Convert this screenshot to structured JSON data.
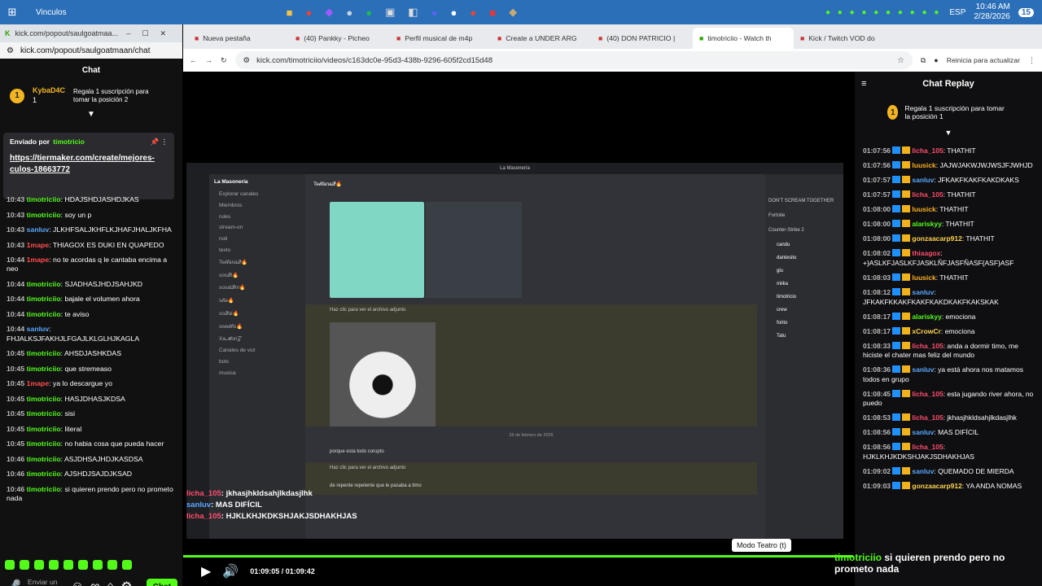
{
  "taskbar": {
    "start_label": "Vinculos",
    "time": "10:46 AM",
    "date": "2/28/2026",
    "lang": "ESP",
    "notif": "15"
  },
  "left_window": {
    "tab_title": "kick.com/popout/saulgoatmaa...",
    "url": "kick.com/popout/saulgoatmaan/chat",
    "chat_title": "Chat",
    "top_user": {
      "name": "KybaD4C",
      "count": "1",
      "rank": "1"
    },
    "gift_text": "Regala 1 suscripción para tomar la posición 2",
    "pinned": {
      "by": "Enviado por",
      "by_user": "timotricio",
      "link": "https://tiermaker.com/create/mejores-culos-18663772"
    },
    "messages": [
      {
        "time": "10:43",
        "user": "timotriciio",
        "color": "#53fc18",
        "text": "HDAJSHDJASHDJKAS"
      },
      {
        "time": "10:43",
        "user": "timotriciio",
        "color": "#53fc18",
        "text": "soy un p"
      },
      {
        "time": "10:43",
        "user": "sanluv",
        "color": "#5aa8ff",
        "text": "JLKHFSALJKHFLKJHAFJHALJKFHA"
      },
      {
        "time": "10:43",
        "user": "1mape",
        "color": "#ff4d4d",
        "text": "THIAGOX ES DUKI EN QUAPEDO"
      },
      {
        "time": "10:44",
        "user": "1mape",
        "color": "#ff4d4d",
        "text": "no te acordas q le cantaba encima a neo"
      },
      {
        "time": "10:44",
        "user": "timotriciio",
        "color": "#53fc18",
        "text": "SJADHASJHDJSAHJKD"
      },
      {
        "time": "10:44",
        "user": "timotriciio",
        "color": "#53fc18",
        "text": "bajale el volumen ahora"
      },
      {
        "time": "10:44",
        "user": "timotriciio",
        "color": "#53fc18",
        "text": "te aviso"
      },
      {
        "time": "10:44",
        "user": "sanluv",
        "color": "#5aa8ff",
        "text": "FHJALKSJFAKHJLFGAJLKLGLHJKAGLA"
      },
      {
        "time": "10:45",
        "user": "timotriciio",
        "color": "#53fc18",
        "text": "AHSDJASHKDAS"
      },
      {
        "time": "10:45",
        "user": "timotriciio",
        "color": "#53fc18",
        "text": "que stremeaso"
      },
      {
        "time": "10:45",
        "user": "1mape",
        "color": "#ff4d4d",
        "text": "ya lo descargue yo"
      },
      {
        "time": "10:45",
        "user": "timotriciio",
        "color": "#53fc18",
        "text": "HASJDHASJKDSA"
      },
      {
        "time": "10:45",
        "user": "timotriciio",
        "color": "#53fc18",
        "text": "sisi"
      },
      {
        "time": "10:45",
        "user": "timotriciio",
        "color": "#53fc18",
        "text": "literal"
      },
      {
        "time": "10:45",
        "user": "timotriciio",
        "color": "#53fc18",
        "text": "no habia cosa que pueda hacer"
      },
      {
        "time": "10:46",
        "user": "timotriciio",
        "color": "#53fc18",
        "text": "ASJDHSAJHDJKASDSA"
      },
      {
        "time": "10:46",
        "user": "timotriciio",
        "color": "#53fc18",
        "text": "AJSHDJSAJDJKSAD"
      },
      {
        "time": "10:46",
        "user": "timotriciio",
        "color": "#53fc18",
        "text": "si quieren prendo pero no prometo nada"
      }
    ],
    "input_placeholder": "Enviar un mensaje",
    "chat_button": "Chat"
  },
  "main_window": {
    "tabs": [
      {
        "label": "Nueva pestaña"
      },
      {
        "label": "(40) Pankky - Picheo"
      },
      {
        "label": "Perfil musical de m4p"
      },
      {
        "label": "Create a UNDER ARG"
      },
      {
        "label": "(40) DON PATRICIO |"
      },
      {
        "label": "timotriciio - Watch th",
        "active": true
      },
      {
        "label": "Kick / Twitch VOD do"
      }
    ],
    "url": "kick.com/timotriciio/videos/c163dc0e-95d3-438b-9296-605f2cd15d48",
    "update_button": "Reinicia para actualizar",
    "video": {
      "current": "01:09:05",
      "total": "01:09:42",
      "progress": 0.991,
      "tooltip": "Modo Teatro (t)"
    },
    "overlay": {
      "user": "timotriciio",
      "text": "si quieren prendo pero no prometo nada"
    },
    "discord": {
      "server": "La Masonería",
      "channel": "Te𝓵𝓵ana𝓠🔥",
      "channels": [
        "Explorar canales",
        "Miembros",
        "rules",
        "stream-on",
        "noti",
        "texto",
        "Te𝓵𝓵ana𝓠🔥",
        "sos𝓠i🔥",
        "sosal𝓠ni🔥",
        "s𝓵ia🔥",
        "so𝓠al🔥",
        "swe𝓵𝓵is🔥",
        "Xa𝓜on𝓩",
        "Canales de voz",
        "bots",
        "musica"
      ],
      "date_divider": "26 de febrero de 2026",
      "messages": [
        {
          "user": "@timotricio",
          "text": "Haz clic para ver el archivo adjunto"
        },
        {
          "user": "pingu",
          "text": "porque esta todo corupto"
        },
        {
          "user": "@timotricio",
          "text": "Haz clic para ver el archivo adjunto"
        },
        {
          "user": "Gonzacarp912",
          "text": "de repente repelente que le pasaba a timo"
        }
      ],
      "activity": [
        "DON'T SCREAM TOGETHER",
        "Fortnite",
        "Counter-Strike 2"
      ],
      "members": [
        "candu",
        "dantesito",
        "glu",
        "miika",
        "timotricio",
        "crew",
        "forito",
        "Tatu"
      ],
      "voice_label": "Voz conectada",
      "overlay_lines": [
        {
          "user": "licha_105",
          "text": "jkhasjhkldsahjlkdasjlhk"
        },
        {
          "user": "sanluv",
          "text": "MAS DIFÍCIL"
        },
        {
          "user": "licha_105",
          "text": "HJKLKHJKDKSHJAKJSDHAKHJAS"
        }
      ],
      "input_placeholder": "Enviar mensaje a #Te𝓵𝓵ana𝓠🔥"
    }
  },
  "replay": {
    "title": "Chat Replay",
    "gift": "Regala 1 suscripción para tomar la posición 1",
    "messages": [
      {
        "time": "01:07:56",
        "user": "licha_105",
        "color": "#ff4d6d",
        "text": "THATHIT"
      },
      {
        "time": "01:07:56",
        "user": "luusick",
        "color": "#ffb020",
        "text": "JAJWJAKWJWJWSJFJWHJD"
      },
      {
        "time": "01:07:57",
        "user": "sanluv",
        "color": "#5aa8ff",
        "text": "JFKAKFKAKFKAKDKAKS"
      },
      {
        "time": "01:07:57",
        "user": "licha_105",
        "color": "#ff4d6d",
        "text": "THATHIT"
      },
      {
        "time": "01:08:00",
        "user": "luusick",
        "color": "#ffb020",
        "text": "THATHIT"
      },
      {
        "time": "01:08:00",
        "user": "alariskyy",
        "color": "#53fc18",
        "text": "THATHIT"
      },
      {
        "time": "01:08:00",
        "user": "gonzaacarp912",
        "color": "#ffd54f",
        "text": "THATHIT"
      },
      {
        "time": "01:08:02",
        "user": "thiaagox",
        "color": "#ff4d6d",
        "text": "+}ASLKFJASLKFJASKLÑFJASFÑASF{ASF}ASF"
      },
      {
        "time": "01:08:03",
        "user": "luusick",
        "color": "#ffb020",
        "text": "THATHIT"
      },
      {
        "time": "01:08:12",
        "user": "sanluv",
        "color": "#5aa8ff",
        "text": "JFKAKFKKAKFKAKFKAKDKAKFKAKSKAK"
      },
      {
        "time": "01:08:17",
        "user": "alariskyy",
        "color": "#53fc18",
        "text": "emociona"
      },
      {
        "time": "01:08:17",
        "user": "xCrowCr",
        "color": "#ffd54f",
        "text": "emociona"
      },
      {
        "time": "01:08:33",
        "user": "licha_105",
        "color": "#ff4d6d",
        "text": "anda a dormir timo, me hiciste el chater mas feliz del mundo"
      },
      {
        "time": "01:08:36",
        "user": "sanluv",
        "color": "#5aa8ff",
        "text": "ya está ahora nos matamos todos en grupo"
      },
      {
        "time": "01:08:45",
        "user": "licha_105",
        "color": "#ff4d6d",
        "text": "esta jugando river ahora, no puedo"
      },
      {
        "time": "01:08:53",
        "user": "licha_105",
        "color": "#ff4d6d",
        "text": "jkhasjhkldsahjlkdasjlhk"
      },
      {
        "time": "01:08:56",
        "user": "sanluv",
        "color": "#5aa8ff",
        "text": "MAS DIFÍCIL"
      },
      {
        "time": "01:08:56",
        "user": "licha_105",
        "color": "#ff4d6d",
        "text": "HJKLKHJKDKSHJAKJSDHAKHJAS"
      },
      {
        "time": "01:09:02",
        "user": "sanluv",
        "color": "#5aa8ff",
        "text": "QUEMADO DE MIERDA"
      },
      {
        "time": "01:09:03",
        "user": "gonzaacarp912",
        "color": "#ffd54f",
        "text": "YA ANDA NOMAS"
      }
    ]
  }
}
